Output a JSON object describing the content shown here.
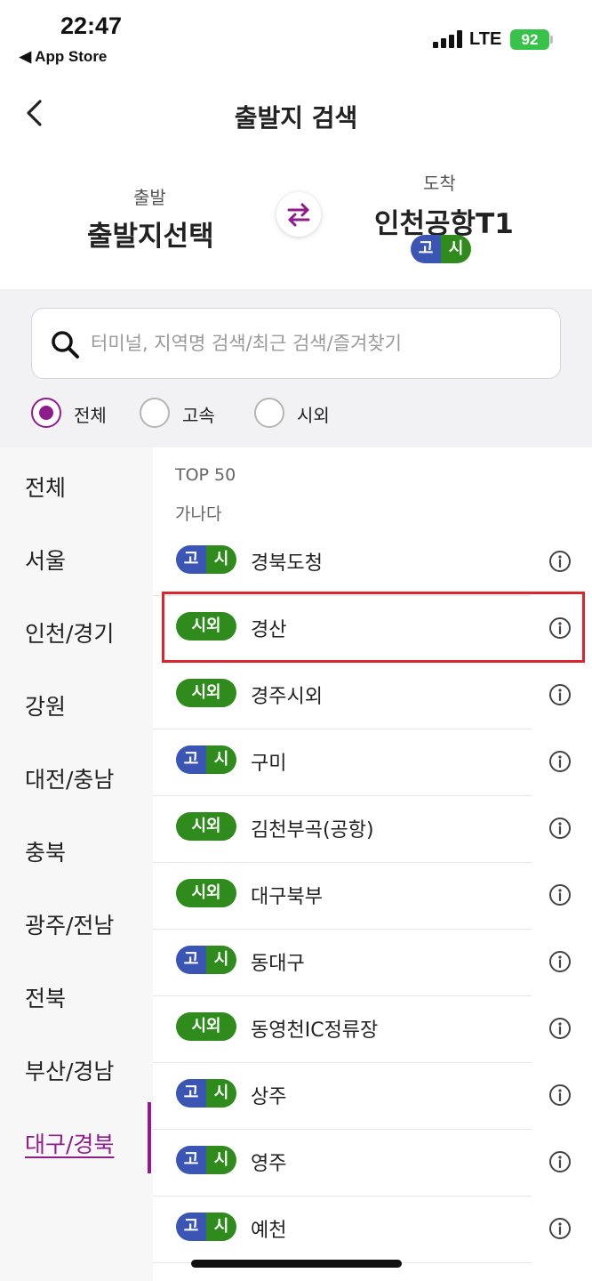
{
  "status_bar": {
    "time": "22:47",
    "back_app": "◀ App Store",
    "network": "LTE",
    "battery": "92"
  },
  "header": {
    "title": "출발지 검색"
  },
  "route": {
    "departure_label": "출발",
    "departure_value": "출발지선택",
    "arrival_label": "도착",
    "arrival_value": "인천공항T1",
    "arrival_badge": {
      "g": "고",
      "s": "시"
    }
  },
  "search": {
    "placeholder": "터미널, 지역명 검색/최근 검색/즐겨찾기",
    "value": ""
  },
  "filters": [
    {
      "label": "전체",
      "selected": true
    },
    {
      "label": "고속",
      "selected": false
    },
    {
      "label": "시외",
      "selected": false
    }
  ],
  "regions": [
    "전체",
    "서울",
    "인천/경기",
    "강원",
    "대전/충남",
    "충북",
    "광주/전남",
    "전북",
    "부산/경남",
    "대구/경북"
  ],
  "active_region": "대구/경북",
  "sort_options": [
    "TOP 50",
    "가나다"
  ],
  "badge_text": {
    "g": "고",
    "s": "시",
    "sw": "시외"
  },
  "terminals": [
    {
      "type": "고시",
      "name": "경북도청"
    },
    {
      "type": "시외",
      "name": "경산"
    },
    {
      "type": "시외",
      "name": "경주시외"
    },
    {
      "type": "고시",
      "name": "구미"
    },
    {
      "type": "시외",
      "name": "김천부곡(공항)"
    },
    {
      "type": "시외",
      "name": "대구북부"
    },
    {
      "type": "고시",
      "name": "동대구"
    },
    {
      "type": "시외",
      "name": "동영천IC정류장"
    },
    {
      "type": "고시",
      "name": "상주"
    },
    {
      "type": "고시",
      "name": "영주"
    },
    {
      "type": "고시",
      "name": "예천"
    }
  ],
  "colors": {
    "accent": "#8e1c8c",
    "express": "#3b55b4",
    "intercity": "#2e8b1c",
    "highlight": "#d9262e"
  }
}
